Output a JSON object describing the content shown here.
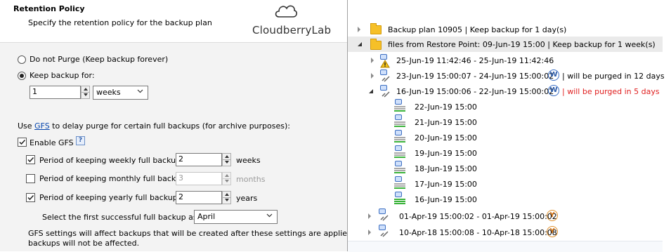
{
  "left": {
    "title": "Retention Policy",
    "subtitle": "Specify the retention policy for the backup plan",
    "logo": "CloudberryLab",
    "radio_do_not_purge": "Do not Purge (Keep backup forever)",
    "radio_keep_backup": "Keep backup for:",
    "keep_value": "1",
    "keep_unit": "weeks",
    "gfs_prefix": "Use ",
    "gfs_link": "GFS",
    "gfs_suffix": " to delay purge for certain full backups (for archive purposes):",
    "enable_gfs": "Enable GFS",
    "help_glyph": "?",
    "weekly_label": "Period of keeping weekly full backups:",
    "weekly_value": "2",
    "weekly_unit": "weeks",
    "monthly_label": "Period of keeping monthly full backups:",
    "monthly_value": "3",
    "monthly_unit": "months",
    "yearly_label": "Period of keeping yearly full backups:",
    "yearly_value": "2",
    "yearly_unit": "years",
    "first_backup_label": "Select the first successful full backup as of:",
    "first_backup_value": "April",
    "note_line1": "GFS settings will affect backups that will be created after these settings are applied. Past",
    "note_line2": "backups will not be affected."
  },
  "tree": {
    "plan": "Backup plan 10905  |   Keep backup for 1 day(s)",
    "restore_point": "files from Restore Point: 09-Jun-19 15:00  |   Keep backup for 1 week(s)",
    "range1": "25-Jun-19 11:42:46 - 25-Jun-19 11:42:46",
    "range2": "23-Jun-19 15:00:07 - 24-Jun-19 15:00:02",
    "range2_badge": "W",
    "range2_note": "| will be purged in 12 days",
    "range3": "16-Jun-19 15:00:06 - 22-Jun-19 15:00:02",
    "range3_badge": "W",
    "range3_note": "| will be purged in 5 days",
    "day1": "22-Jun-19 15:00",
    "day2": "21-Jun-19 15:00",
    "day3": "20-Jun-19 15:00",
    "day4": "19-Jun-19 15:00",
    "day5": "18-Jun-19 15:00",
    "day6": "17-Jun-19 15:00",
    "day7": "16-Jun-19 15:00",
    "range4": "01-Apr-19 15:00:02 - 01-Apr-19 15:00:02",
    "range4_badge": "Y",
    "range5": "10-Apr-18 15:00:08 - 10-Apr-18 15:00:08",
    "range5_badge": "Y"
  },
  "colors": {
    "purge_warning": "#e02020",
    "link": "#0645ad",
    "gfs_bar_green": "#3bb33b"
  }
}
